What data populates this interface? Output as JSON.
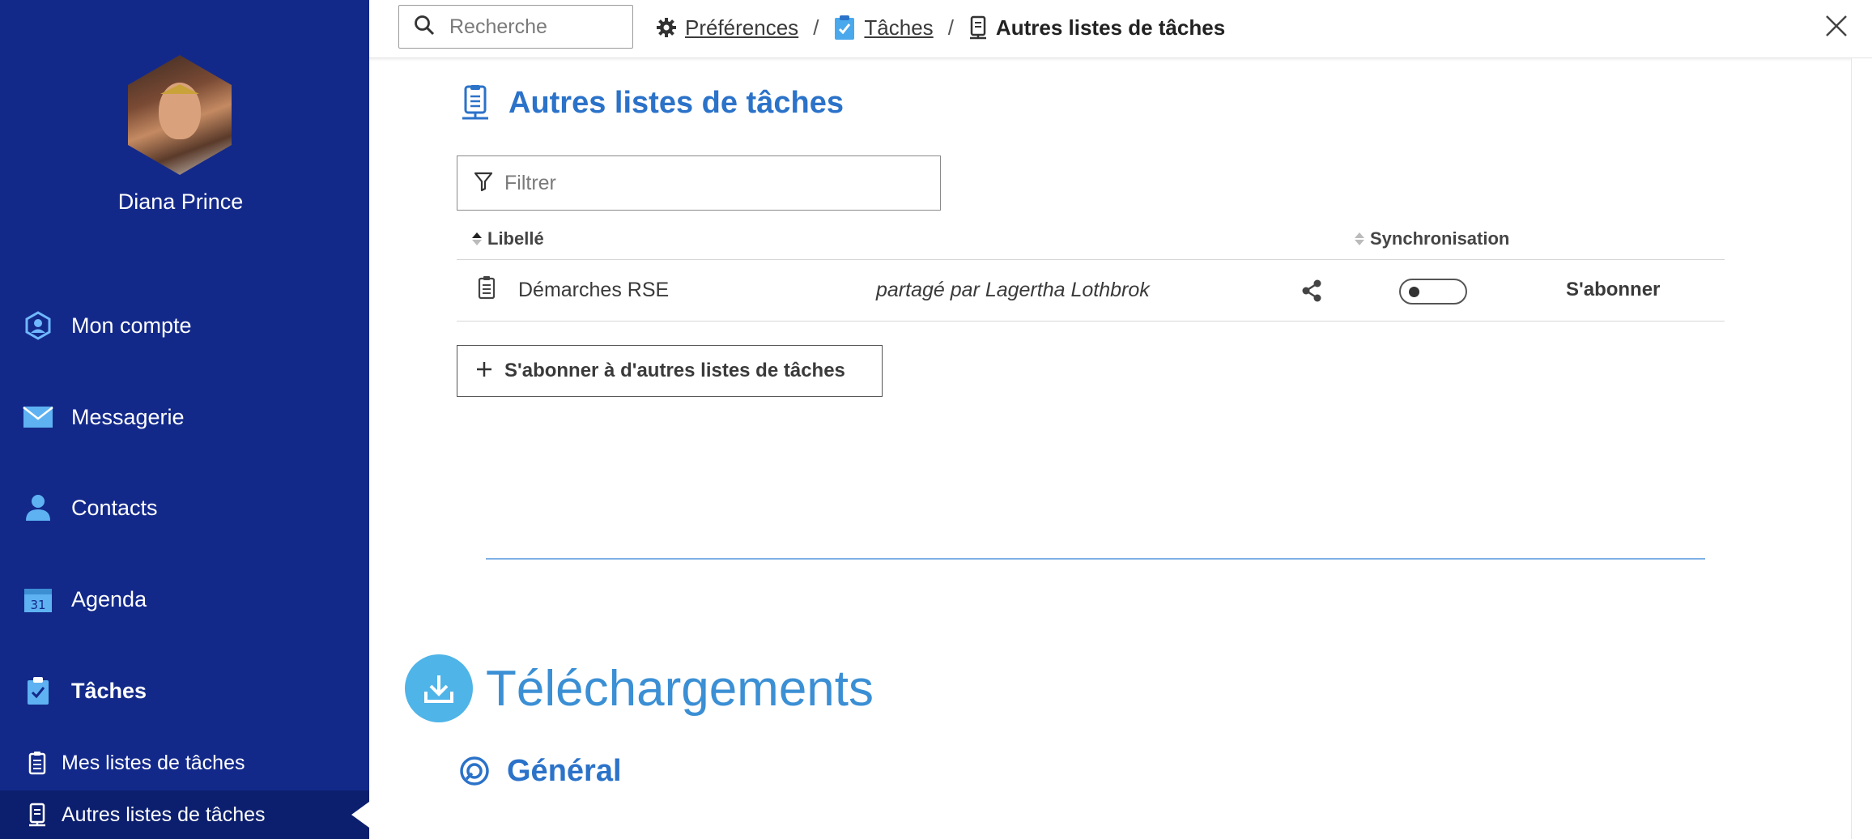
{
  "sidebar": {
    "user_name": "Diana Prince",
    "nav": [
      {
        "label": "Mon compte",
        "icon": "account-icon"
      },
      {
        "label": "Messagerie",
        "icon": "mail-icon"
      },
      {
        "label": "Contacts",
        "icon": "contact-icon"
      },
      {
        "label": "Agenda",
        "icon": "calendar-icon",
        "icon_text": "31"
      },
      {
        "label": "Tâches",
        "icon": "tasks-icon"
      }
    ],
    "sub_items": [
      {
        "label": "Mes listes de tâches",
        "icon": "task-list-icon"
      },
      {
        "label": "Autres listes de tâches",
        "icon": "other-task-list-icon",
        "active": true
      }
    ]
  },
  "topbar": {
    "search_placeholder": "Recherche",
    "breadcrumb": {
      "preferences": "Préférences",
      "tasks": "Tâches",
      "current": "Autres listes de tâches",
      "separator": "/"
    }
  },
  "main": {
    "title": "Autres listes de tâches",
    "filter_placeholder": "Filtrer",
    "columns": {
      "label": "Libellé",
      "sync": "Synchronisation"
    },
    "rows": [
      {
        "label": "Démarches RSE",
        "owner": "partagé par Lagertha Lothbrok",
        "sync_enabled": false,
        "action": "S'abonner"
      }
    ],
    "subscribe_button": "S'abonner à d'autres listes de tâches",
    "downloads_title": "Téléchargements",
    "general_title": "Général"
  },
  "colors": {
    "sidebar_bg": "#13298a",
    "accent_blue": "#2b72c9",
    "downloads_circle": "#4fb4e8"
  }
}
